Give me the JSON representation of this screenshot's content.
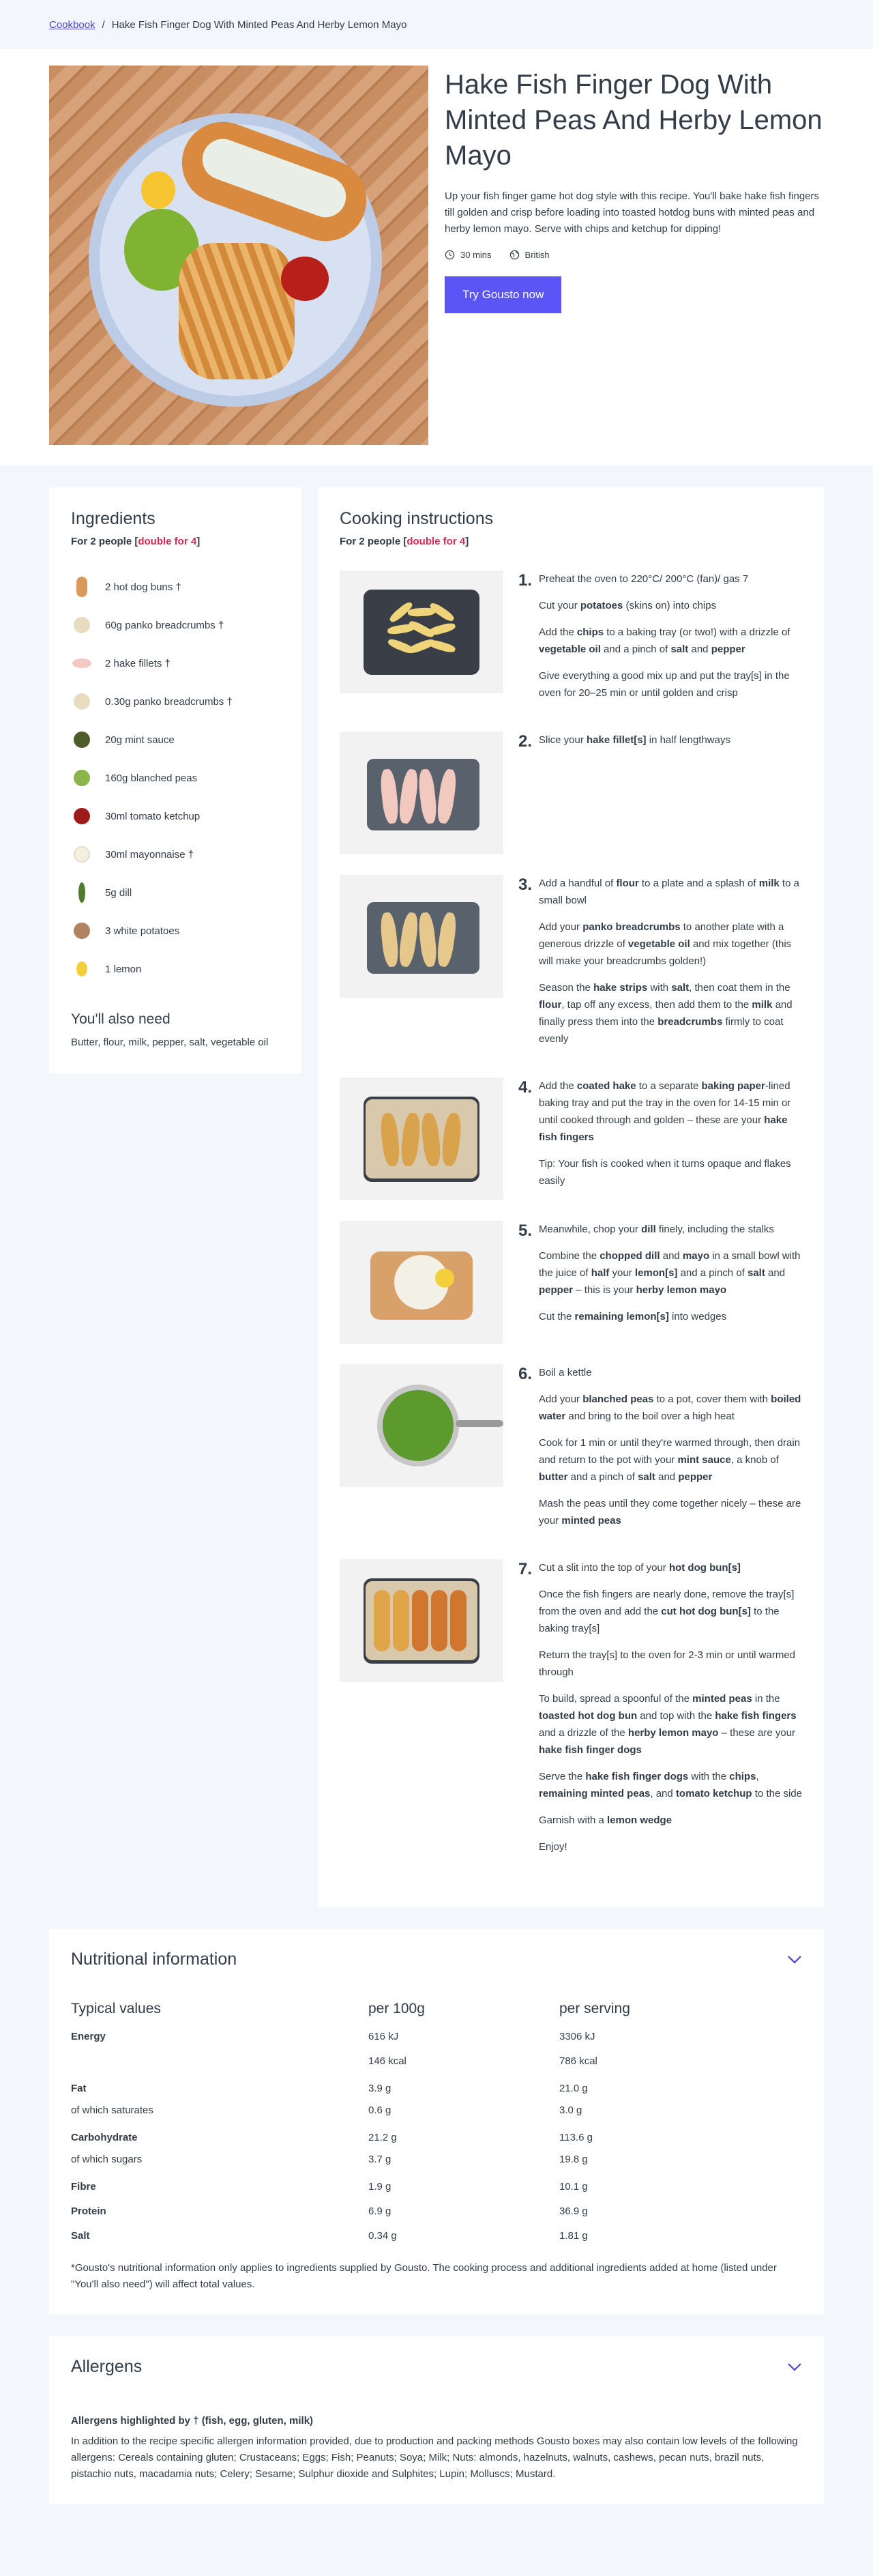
{
  "breadcrumb": {
    "root": "Cookbook",
    "separator": "/",
    "current": "Hake Fish Finger Dog With Minted Peas And Herby Lemon Mayo"
  },
  "hero": {
    "title": "Hake Fish Finger Dog With Minted Peas And Herby Lemon Mayo",
    "description": "Up your fish finger game hot dog style with this recipe. You'll bake hake fish fingers till golden and crisp before loading into toasted hotdog buns with minted peas and herby lemon mayo. Serve with chips and ketchup for dipping!",
    "time": "30 mins",
    "cuisine": "British",
    "cta": "Try Gousto now",
    "image_icon": "recipe-photo"
  },
  "ingredients": {
    "title": "Ingredients",
    "portions_prefix": "For 2 people [",
    "portions_double": "double for 4",
    "portions_suffix": "]",
    "items": [
      {
        "label": "2 hot dog buns †",
        "icon": "bun-icon",
        "color": "#d99a5b"
      },
      {
        "label": "60g panko breadcrumbs †",
        "icon": "breadcrumbs-icon",
        "color": "#e8dcc0"
      },
      {
        "label": "2 hake fillets †",
        "icon": "fish-icon",
        "color": "#f3c9c4"
      },
      {
        "label": "0.30g panko breadcrumbs †",
        "icon": "breadcrumbs-icon",
        "color": "#e8dcc0"
      },
      {
        "label": "20g mint sauce",
        "icon": "mint-sauce-icon",
        "color": "#4d5c2b"
      },
      {
        "label": "160g blanched peas",
        "icon": "peas-icon",
        "color": "#8bb44a"
      },
      {
        "label": "30ml tomato ketchup",
        "icon": "ketchup-icon",
        "color": "#9e1b1b"
      },
      {
        "label": "30ml mayonnaise †",
        "icon": "mayo-icon",
        "color": "#f4efdf"
      },
      {
        "label": "5g dill",
        "icon": "dill-icon",
        "color": "#4f7d2b"
      },
      {
        "label": "3 white potatoes",
        "icon": "potato-icon",
        "color": "#b08463"
      },
      {
        "label": "1 lemon",
        "icon": "lemon-icon",
        "color": "#f3cf3c"
      }
    ],
    "also_title": "You'll also need",
    "also_text": "Butter, flour, milk, pepper, salt, vegetable oil"
  },
  "instructions": {
    "title": "Cooking instructions",
    "portions_prefix": "For 2 people [",
    "portions_double": "double for 4",
    "portions_suffix": "]",
    "steps": [
      {
        "num": "1.",
        "paragraphs": [
          "Preheat the oven to 220°C/ 200°C (fan)/ gas 7",
          "Cut your <b>potatoes</b> (skins on) into chips",
          "Add the <b>chips</b> to a baking tray (or two!) with a drizzle of <b>vegetable oil</b> and a pinch of <b>salt</b> and <b>pepper</b>",
          "Give everything a good mix up and put the tray[s] in the oven for 20–25 min or until golden and crisp"
        ]
      },
      {
        "num": "2.",
        "paragraphs": [
          "Slice your <b>hake fillet[s]</b> in half lengthways"
        ]
      },
      {
        "num": "3.",
        "paragraphs": [
          "Add a handful of <b>flour</b> to a plate and a splash of <b>milk</b> to a small bowl",
          "Add your <b>panko breadcrumbs</b> to another plate with a generous drizzle of <b>vegetable oil</b> and mix together (this will make your breadcrumbs golden!)",
          "Season the <b>hake strips</b> with <b>salt</b>, then coat them in the <b>flour</b>, tap off any excess, then add them to the <b>milk</b> and finally press them into the <b>breadcrumbs</b> firmly to coat evenly"
        ]
      },
      {
        "num": "4.",
        "paragraphs": [
          "Add the <b>coated hake</b> to a separate <b>baking paper</b>-lined baking tray and put the tray in the oven for 14-15 min or until cooked through and golden – these are your <b>hake fish fingers</b>",
          "Tip: Your fish is cooked when it turns opaque and flakes easily"
        ]
      },
      {
        "num": "5.",
        "paragraphs": [
          "Meanwhile, chop your <b>dill</b> finely, including the stalks",
          "Combine the <b>chopped dill</b> and <b>mayo</b> in a small bowl with the juice of <b>half</b> your <b>lemon[s]</b> and a pinch of <b>salt</b> and <b>pepper</b> – this is your <b>herby lemon mayo</b>",
          "Cut the <b>remaining lemon[s]</b> into wedges"
        ]
      },
      {
        "num": "6.",
        "paragraphs": [
          "Boil a kettle",
          "Add your <b>blanched peas</b> to a pot, cover them with <b>boiled water</b> and bring to the boil over a high heat",
          "Cook for 1 min or until they're warmed through, then drain and return to the pot with your <b>mint sauce</b>, a knob of <b>butter</b> and a pinch of <b>salt</b> and <b>pepper</b>",
          "Mash the peas until they come together nicely – these are your <b>minted peas</b>"
        ]
      },
      {
        "num": "7.",
        "paragraphs": [
          "Cut a slit into the top of your <b>hot dog bun[s]</b>",
          "Once the fish fingers are nearly done, remove the tray[s] from the oven and add the <b>cut hot dog bun[s]</b> to the baking tray[s]",
          "Return the tray[s] to the oven for 2-3 min or until warmed through",
          "To build, spread a spoonful of the <b>minted peas</b> in the <b>toasted hot dog bun</b> and top with the <b>hake fish fingers</b> and a drizzle of the <b>herby lemon mayo</b> – these are your <b>hake fish finger dogs</b>",
          "Serve the <b>hake fish finger dogs</b> with the <b>chips</b>, <b>remaining minted peas</b>, and <b>tomato ketchup</b> to the side",
          "Garnish with a <b>lemon wedge</b>",
          "Enjoy!"
        ]
      }
    ]
  },
  "nutrition": {
    "title": "Nutritional information",
    "headers": [
      "Typical values",
      "per 100g",
      "per serving"
    ],
    "rows": [
      {
        "name": "Energy",
        "per100": "616 kJ",
        "serving": "3306 kJ",
        "bold": true
      },
      {
        "name": "",
        "per100": "146 kcal",
        "serving": "786 kcal",
        "bold": false
      },
      {
        "name": "Fat",
        "per100": "3.9 g",
        "serving": "21.0 g",
        "bold": true,
        "gap": true
      },
      {
        "name": "of which saturates",
        "per100": "0.6 g",
        "serving": "3.0 g",
        "bold": false
      },
      {
        "name": "Carbohydrate",
        "per100": "21.2 g",
        "serving": "113.6 g",
        "bold": true,
        "gap": true
      },
      {
        "name": "of which sugars",
        "per100": "3.7 g",
        "serving": "19.8 g",
        "bold": false
      },
      {
        "name": "Fibre",
        "per100": "1.9 g",
        "serving": "10.1 g",
        "bold": true,
        "gap": true
      },
      {
        "name": "Protein",
        "per100": "6.9 g",
        "serving": "36.9 g",
        "bold": true,
        "gap": true
      },
      {
        "name": "Salt",
        "per100": "0.34 g",
        "serving": "1.81 g",
        "bold": true,
        "gap": true
      }
    ],
    "note": "*Gousto's nutritional information only applies to ingredients supplied by Gousto. The cooking process and additional ingredients added at home (listed under \"You'll also need\") will affect total values."
  },
  "allergens": {
    "title": "Allergens",
    "highlight": "Allergens highlighted by † (fish, egg, gluten, milk)",
    "text": "In addition to the recipe specific allergen information provided, due to production and packing methods Gousto boxes may also contain low levels of the following allergens: Cereals containing gluten; Crustaceans; Eggs; Fish; Peanuts; Soya; Milk; Nuts: almonds, hazelnuts, walnuts, cashews, pecan nuts, brazil nuts, pistachio nuts, macadamia nuts; Celery; Sesame; Sulphur dioxide and Sulphites; Lupin; Molluscs; Mustard."
  },
  "colors": {
    "accent": "#5a55f5",
    "link": "#4a46c8",
    "double": "#d12c57"
  }
}
